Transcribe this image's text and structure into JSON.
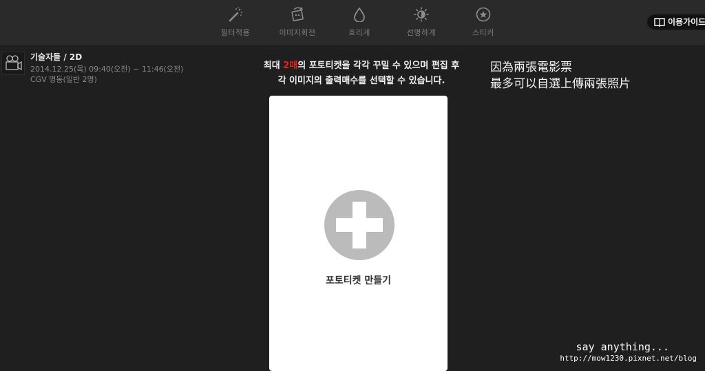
{
  "toolbar": {
    "items": [
      {
        "label": "필터적용",
        "icon": "magic-wand-icon"
      },
      {
        "label": "이미지회전",
        "icon": "rotate-image-icon"
      },
      {
        "label": "흐리게",
        "icon": "blur-drop-icon"
      },
      {
        "label": "선명하게",
        "icon": "sharpen-icon"
      },
      {
        "label": "스티커",
        "icon": "sticker-icon"
      }
    ],
    "guide_label": "이용가이드",
    "guide_icon": "book-icon"
  },
  "movie": {
    "icon": "movie-camera-icon",
    "title": "기술자들 / 2D",
    "time": "2014.12.25(목)  09:40(오전) ~ 11:46(오전)",
    "cinema": "CGV 명동(일반 2명)"
  },
  "info": {
    "line1_prefix": "최대 ",
    "line1_count": "2매",
    "line1_suffix": "의 포토티켓을 각각 꾸밀 수 있으며 편집 후",
    "line2": "각 이미지의 출력매수를 선택할 수 있습니다."
  },
  "note": {
    "line1": "因為兩張電影票",
    "line2": "最多可以自選上傳兩張照片"
  },
  "card": {
    "icon": "plus-circle-icon",
    "label": "포토티켓 만들기"
  },
  "watermark": {
    "line1": "say anything...",
    "line2": "http://mow1230.pixnet.net/blog"
  },
  "colors": {
    "background": "#1f1f1f",
    "toolbar": "#2a2a2a",
    "accent_red": "#e2231a",
    "card": "#ffffff",
    "plus_circle": "#bbbbbb"
  }
}
